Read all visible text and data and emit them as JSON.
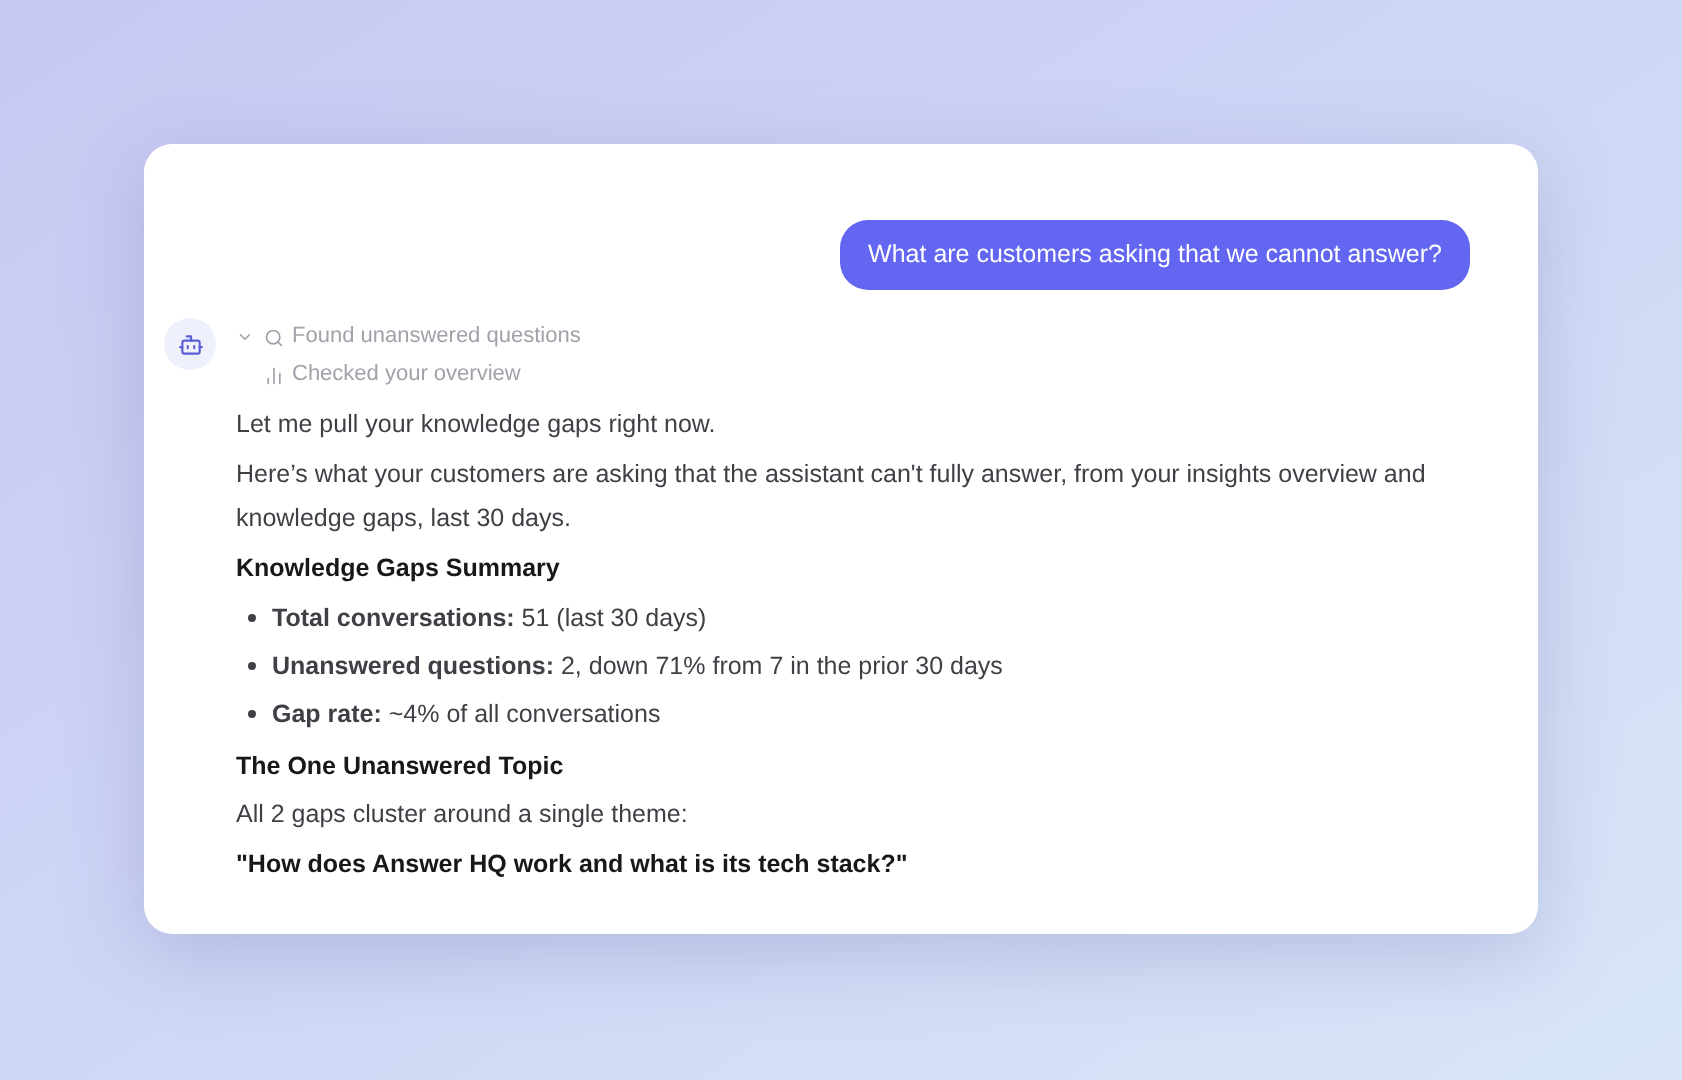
{
  "user_message": "What are customers asking that we cannot answer?",
  "steps": [
    {
      "kind": "search",
      "label": "Found unanswered questions"
    },
    {
      "kind": "chart",
      "label": "Checked your overview"
    }
  ],
  "reply": [
    {
      "kind": "paragraph",
      "text": "Let me pull your knowledge gaps right now."
    },
    {
      "kind": "paragraph",
      "text": "Here’s what your customers are asking that the assistant can't fully answer, from your insights overview and knowledge gaps, last 30 days."
    },
    {
      "kind": "heading",
      "text": "Knowledge Gaps Summary"
    },
    {
      "kind": "bullet",
      "text": "**Total conversations:** 51 (last 30 days)"
    },
    {
      "kind": "bullet",
      "text": "**Unanswered questions:** 2, down 71% from 7 in the prior 30 days"
    },
    {
      "kind": "bullet",
      "text": "**Gap rate:** ~4% of all conversations"
    },
    {
      "kind": "heading",
      "text": "The One Unanswered Topic"
    },
    {
      "kind": "paragraph",
      "text": "All 2 gaps cluster around a single theme:"
    },
    {
      "kind": "heading",
      "text": "\"How does Answer HQ work and what is its tech stack?\""
    }
  ]
}
